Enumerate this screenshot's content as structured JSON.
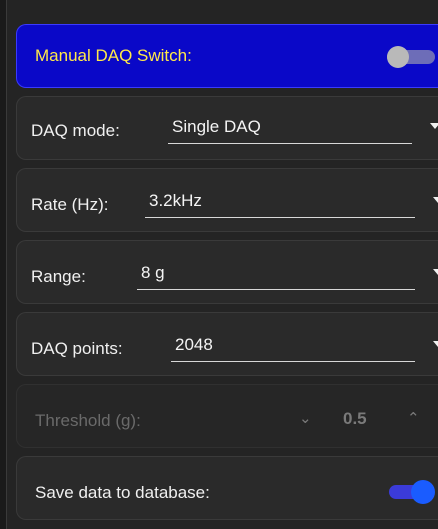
{
  "manual_daq": {
    "label": "Manual DAQ Switch:",
    "enabled": false
  },
  "daq_mode": {
    "label": "DAQ mode:",
    "value": "Single DAQ"
  },
  "rate": {
    "label": "Rate (Hz):",
    "value": "3.2kHz"
  },
  "range": {
    "label": "Range:",
    "value": "8 g"
  },
  "daq_points": {
    "label": "DAQ points:",
    "value": "2048"
  },
  "threshold": {
    "label": "Threshold (g):",
    "value": "0.5",
    "disabled": true
  },
  "save_db": {
    "label": "Save data to database:",
    "enabled": true
  },
  "colors": {
    "switch_panel_bg": "#0a08c8",
    "switch_label": "#ffe94a",
    "toggle_on": "#1a5cff",
    "panel_bg": "#2a2a2a"
  }
}
